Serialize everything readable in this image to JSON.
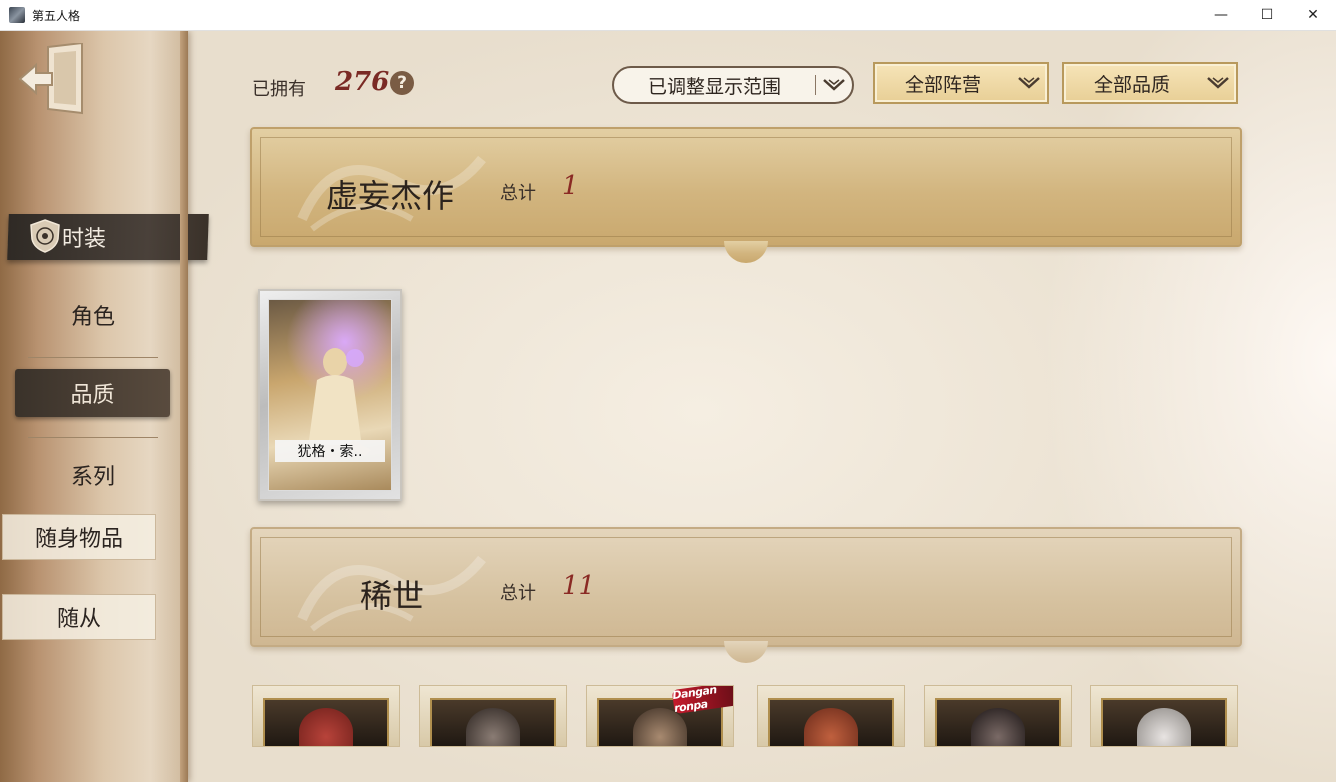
{
  "window": {
    "title": "第五人格",
    "minimize_glyph": "—",
    "maximize_glyph": "☐",
    "close_glyph": "✕"
  },
  "sidebar": {
    "exit_icon": "exit-door-icon",
    "items": [
      {
        "label": "时装",
        "active": true,
        "icon": "shield-emblem-icon"
      },
      {
        "label": "角色"
      },
      {
        "label": "品质",
        "selected": true
      },
      {
        "label": "系列"
      },
      {
        "label": "随身物品"
      },
      {
        "label": "随从"
      }
    ]
  },
  "header": {
    "owned_label": "已拥有",
    "owned_count": "276",
    "help_glyph": "?",
    "filters": [
      {
        "label": "已调整显示范围"
      },
      {
        "label": "全部阵营"
      },
      {
        "label": "全部品质"
      }
    ]
  },
  "sections": [
    {
      "title": "虚妄杰作",
      "total_label": "总计",
      "total_value": "1",
      "cards": [
        {
          "name": "犹格・索.."
        }
      ]
    },
    {
      "title": "稀世",
      "total_label": "总计",
      "total_value": "11",
      "cards": [
        {
          "name": ""
        },
        {
          "name": ""
        },
        {
          "name": ""
        },
        {
          "name": ""
        },
        {
          "name": ""
        },
        {
          "name": ""
        }
      ],
      "badge": "Dangan ronpa"
    }
  ],
  "colors": {
    "accent_red": "#7a2a25",
    "banner_gold": "#d2b57f",
    "sidebar_active": "#2f2a25"
  }
}
